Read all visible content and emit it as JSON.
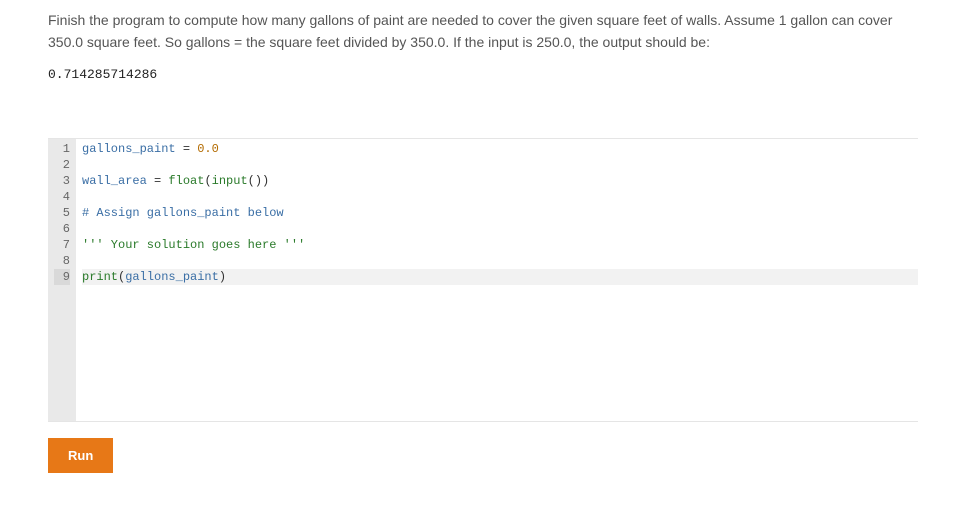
{
  "prompt": {
    "paragraph": "Finish the program to compute how many gallons of paint are needed to cover the given square feet of walls. Assume 1 gallon can cover 350.0 square feet. So gallons = the square feet divided by 350.0. If the input is 250.0, the output should be:",
    "expected_output": "0.714285714286"
  },
  "editor": {
    "active_line": 9,
    "lines": [
      {
        "n": 1,
        "tokens": [
          {
            "t": "gallons_paint",
            "c": "tok-ident"
          },
          {
            "t": " = ",
            "c": "tok-plain"
          },
          {
            "t": "0.0",
            "c": "tok-num"
          }
        ]
      },
      {
        "n": 2,
        "tokens": []
      },
      {
        "n": 3,
        "tokens": [
          {
            "t": "wall_area",
            "c": "tok-ident"
          },
          {
            "t": " = ",
            "c": "tok-plain"
          },
          {
            "t": "float",
            "c": "tok-func"
          },
          {
            "t": "(",
            "c": "tok-plain"
          },
          {
            "t": "input",
            "c": "tok-func"
          },
          {
            "t": "())",
            "c": "tok-plain"
          }
        ]
      },
      {
        "n": 4,
        "tokens": []
      },
      {
        "n": 5,
        "tokens": [
          {
            "t": "# Assign gallons_paint below",
            "c": "tok-comment"
          }
        ]
      },
      {
        "n": 6,
        "tokens": []
      },
      {
        "n": 7,
        "tokens": [
          {
            "t": "''' Your solution goes here '''",
            "c": "tok-str"
          }
        ]
      },
      {
        "n": 8,
        "tokens": []
      },
      {
        "n": 9,
        "tokens": [
          {
            "t": "print",
            "c": "tok-func"
          },
          {
            "t": "(",
            "c": "tok-plain"
          },
          {
            "t": "gallons_paint",
            "c": "tok-ident"
          },
          {
            "t": ")",
            "c": "tok-plain"
          }
        ]
      }
    ]
  },
  "buttons": {
    "run_label": "Run"
  }
}
